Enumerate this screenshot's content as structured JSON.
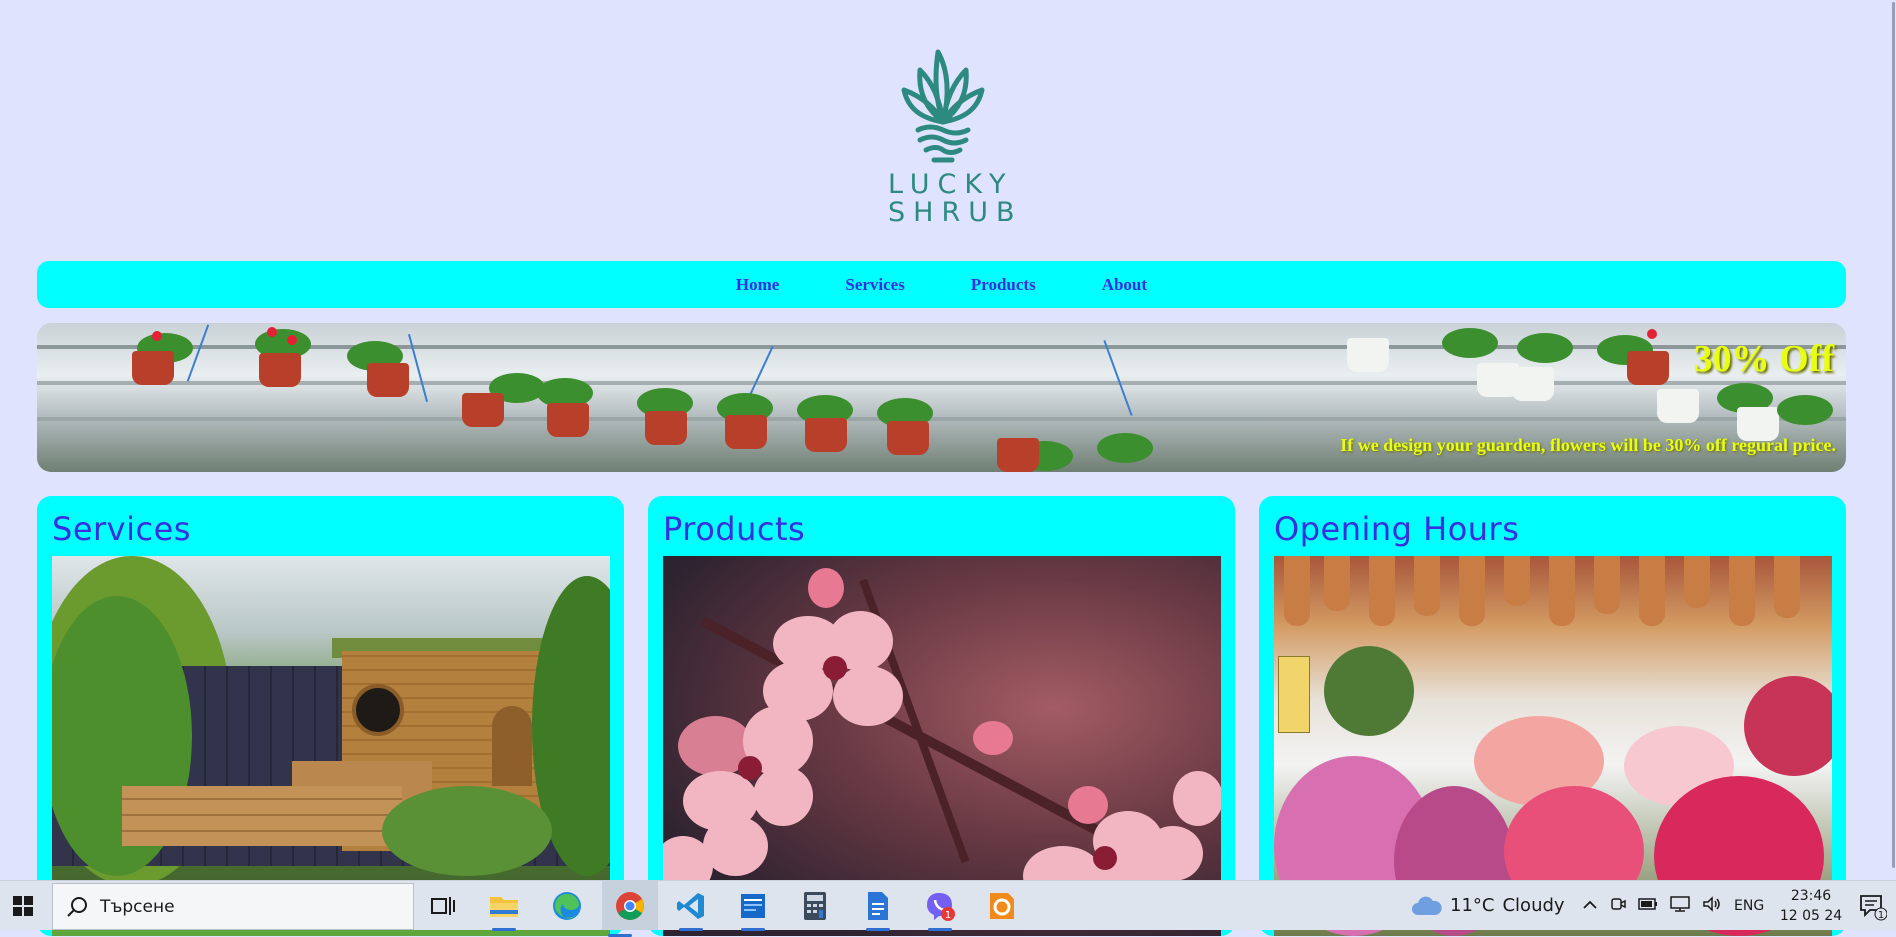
{
  "brand": {
    "line1": "LUCKY",
    "line2": "SHRUB"
  },
  "nav": [
    "Home",
    "Services",
    "Products",
    "About"
  ],
  "banner": {
    "title": "30% Off",
    "text": "If we design your guarden, flowers will be 30% off regural price."
  },
  "cards": [
    {
      "title": "Services"
    },
    {
      "title": "Products"
    },
    {
      "title": "Opening Hours"
    }
  ],
  "taskbar": {
    "search_placeholder": "Търсене",
    "weather_temp": "11°C",
    "weather_cond": "Cloudy",
    "lang": "ENG",
    "time": "23:46",
    "date": "12 05 24",
    "notif_count": "1",
    "viber_badge": "1"
  },
  "colors": {
    "accent": "#00ffff",
    "link": "#3a2fe0",
    "promo": "#e9ff12",
    "page_bg": "#e0e3fd",
    "brand": "#2d8a80"
  }
}
